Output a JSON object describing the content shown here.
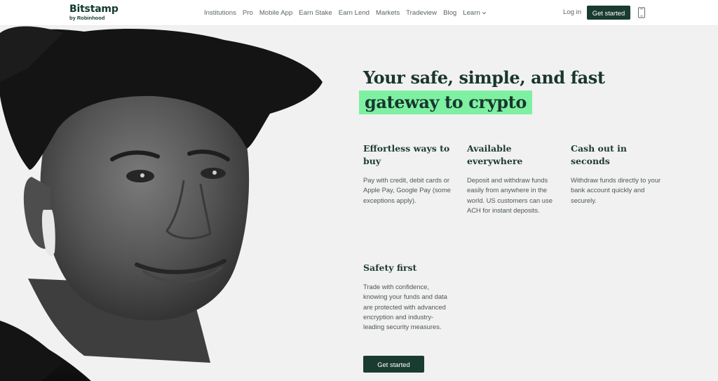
{
  "header": {
    "logo": {
      "name": "Bitstamp",
      "sub": "by Robinhood"
    },
    "nav": [
      {
        "label": "Institutions"
      },
      {
        "label": "Pro"
      },
      {
        "label": "Mobile App"
      },
      {
        "label": "Earn Stake"
      },
      {
        "label": "Earn Lend"
      },
      {
        "label": "Markets"
      },
      {
        "label": "Tradeview"
      },
      {
        "label": "Blog"
      },
      {
        "label": "Learn"
      }
    ],
    "login": "Log in",
    "get_started": "Get started"
  },
  "hero": {
    "headline_line1": "Your safe, simple, and fast",
    "headline_line2": "gateway to crypto",
    "features": [
      {
        "title": "Effortless ways to buy",
        "text": "Pay with credit, debit cards or Apple Pay, Google Pay (some exceptions apply)."
      },
      {
        "title": "Available everywhere",
        "text": "Deposit and withdraw funds easily from anywhere in the world. US customers can use ACH for instant deposits."
      },
      {
        "title": "Cash out in seconds",
        "text": "Withdraw funds directly to your bank account quickly and securely."
      },
      {
        "title": "Safety first",
        "text": "Trade with confidence, knowing your funds and data are protected with advanced encryption and industry-leading security measures."
      }
    ],
    "cta": "Get started"
  },
  "colors": {
    "brand_dark": "#1a3c30",
    "highlight": "#7ef0a2",
    "hero_bg": "#f1f1f1"
  },
  "icons": [
    "chevron-down-icon",
    "mobile-phone-icon"
  ]
}
